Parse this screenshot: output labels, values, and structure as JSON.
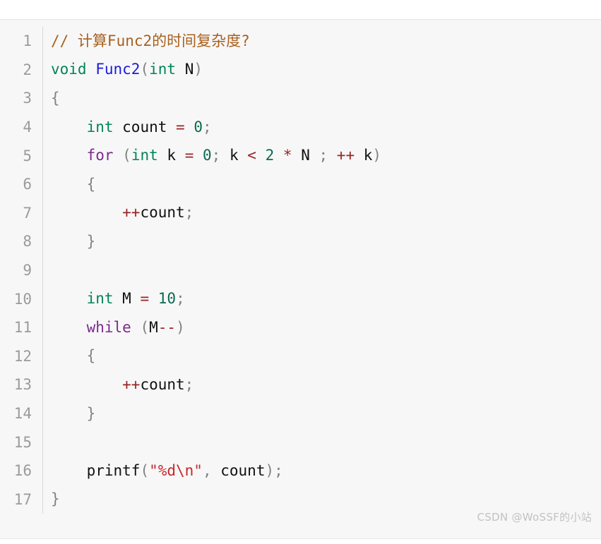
{
  "code_block": {
    "language": "c",
    "background_color": "#f7f7f8",
    "gutter_color": "#9b9b9b",
    "lines": [
      {
        "number": "1",
        "text": "// 计算Func2的时间复杂度?"
      },
      {
        "number": "2",
        "text": "void Func2(int N)"
      },
      {
        "number": "3",
        "text": "{"
      },
      {
        "number": "4",
        "text": "    int count = 0;"
      },
      {
        "number": "5",
        "text": "    for (int k = 0; k < 2 * N ; ++ k)"
      },
      {
        "number": "6",
        "text": "    {"
      },
      {
        "number": "7",
        "text": "        ++count;"
      },
      {
        "number": "8",
        "text": "    }"
      },
      {
        "number": "9",
        "text": ""
      },
      {
        "number": "10",
        "text": "    int M = 10;"
      },
      {
        "number": "11",
        "text": "    while (M--)"
      },
      {
        "number": "12",
        "text": "    {"
      },
      {
        "number": "13",
        "text": "        ++count;"
      },
      {
        "number": "14",
        "text": "    }"
      },
      {
        "number": "15",
        "text": ""
      },
      {
        "number": "16",
        "text": "    printf(\"%d\\n\", count);"
      },
      {
        "number": "17",
        "text": "}"
      }
    ],
    "tokens": {
      "l1": [
        {
          "c": "t-comment",
          "s": "// 计算Func2的时间复杂度?"
        }
      ],
      "l2": [
        {
          "c": "t-typeg",
          "s": "void"
        },
        {
          "c": "t-plain",
          "s": " "
        },
        {
          "c": "t-func",
          "s": "Func2"
        },
        {
          "c": "t-punct",
          "s": "("
        },
        {
          "c": "t-typeg",
          "s": "int"
        },
        {
          "c": "t-plain",
          "s": " N"
        },
        {
          "c": "t-punct",
          "s": ")"
        }
      ],
      "l3": [
        {
          "c": "t-punct",
          "s": "{"
        }
      ],
      "l4": [
        {
          "c": "t-plain",
          "s": "    "
        },
        {
          "c": "t-typeg",
          "s": "int"
        },
        {
          "c": "t-plain",
          "s": " count "
        },
        {
          "c": "t-op",
          "s": "="
        },
        {
          "c": "t-plain",
          "s": " "
        },
        {
          "c": "t-num",
          "s": "0"
        },
        {
          "c": "t-punct",
          "s": ";"
        }
      ],
      "l5": [
        {
          "c": "t-plain",
          "s": "    "
        },
        {
          "c": "t-keyword",
          "s": "for"
        },
        {
          "c": "t-plain",
          "s": " "
        },
        {
          "c": "t-punct",
          "s": "("
        },
        {
          "c": "t-typeg",
          "s": "int"
        },
        {
          "c": "t-plain",
          "s": " k "
        },
        {
          "c": "t-op",
          "s": "="
        },
        {
          "c": "t-plain",
          "s": " "
        },
        {
          "c": "t-num",
          "s": "0"
        },
        {
          "c": "t-punct",
          "s": ";"
        },
        {
          "c": "t-plain",
          "s": " k "
        },
        {
          "c": "t-op",
          "s": "<"
        },
        {
          "c": "t-plain",
          "s": " "
        },
        {
          "c": "t-num",
          "s": "2"
        },
        {
          "c": "t-plain",
          "s": " "
        },
        {
          "c": "t-op",
          "s": "*"
        },
        {
          "c": "t-plain",
          "s": " N "
        },
        {
          "c": "t-punct",
          "s": ";"
        },
        {
          "c": "t-plain",
          "s": " "
        },
        {
          "c": "t-op",
          "s": "++"
        },
        {
          "c": "t-plain",
          "s": " k"
        },
        {
          "c": "t-punct",
          "s": ")"
        }
      ],
      "l6": [
        {
          "c": "t-plain",
          "s": "    "
        },
        {
          "c": "t-punct",
          "s": "{"
        }
      ],
      "l7": [
        {
          "c": "t-plain",
          "s": "        "
        },
        {
          "c": "t-op",
          "s": "++"
        },
        {
          "c": "t-plain",
          "s": "count"
        },
        {
          "c": "t-punct",
          "s": ";"
        }
      ],
      "l8": [
        {
          "c": "t-plain",
          "s": "    "
        },
        {
          "c": "t-punct",
          "s": "}"
        }
      ],
      "l9": [
        {
          "c": "t-plain",
          "s": ""
        }
      ],
      "l10": [
        {
          "c": "t-plain",
          "s": "    "
        },
        {
          "c": "t-typeg",
          "s": "int"
        },
        {
          "c": "t-plain",
          "s": " M "
        },
        {
          "c": "t-op",
          "s": "="
        },
        {
          "c": "t-plain",
          "s": " "
        },
        {
          "c": "t-num",
          "s": "10"
        },
        {
          "c": "t-punct",
          "s": ";"
        }
      ],
      "l11": [
        {
          "c": "t-plain",
          "s": "    "
        },
        {
          "c": "t-keyword",
          "s": "while"
        },
        {
          "c": "t-plain",
          "s": " "
        },
        {
          "c": "t-punct",
          "s": "("
        },
        {
          "c": "t-plain",
          "s": "M"
        },
        {
          "c": "t-op",
          "s": "--"
        },
        {
          "c": "t-punct",
          "s": ")"
        }
      ],
      "l12": [
        {
          "c": "t-plain",
          "s": "    "
        },
        {
          "c": "t-punct",
          "s": "{"
        }
      ],
      "l13": [
        {
          "c": "t-plain",
          "s": "        "
        },
        {
          "c": "t-op",
          "s": "++"
        },
        {
          "c": "t-plain",
          "s": "count"
        },
        {
          "c": "t-punct",
          "s": ";"
        }
      ],
      "l14": [
        {
          "c": "t-plain",
          "s": "    "
        },
        {
          "c": "t-punct",
          "s": "}"
        }
      ],
      "l15": [
        {
          "c": "t-plain",
          "s": ""
        }
      ],
      "l16": [
        {
          "c": "t-plain",
          "s": "    printf"
        },
        {
          "c": "t-punct",
          "s": "("
        },
        {
          "c": "t-string",
          "s": "\"%d\\n\""
        },
        {
          "c": "t-punct",
          "s": ","
        },
        {
          "c": "t-plain",
          "s": " count"
        },
        {
          "c": "t-punct",
          "s": ");"
        }
      ],
      "l17": [
        {
          "c": "t-punct",
          "s": "}"
        }
      ]
    }
  },
  "watermark": {
    "text": "CSDN @WoSSF的小站"
  }
}
